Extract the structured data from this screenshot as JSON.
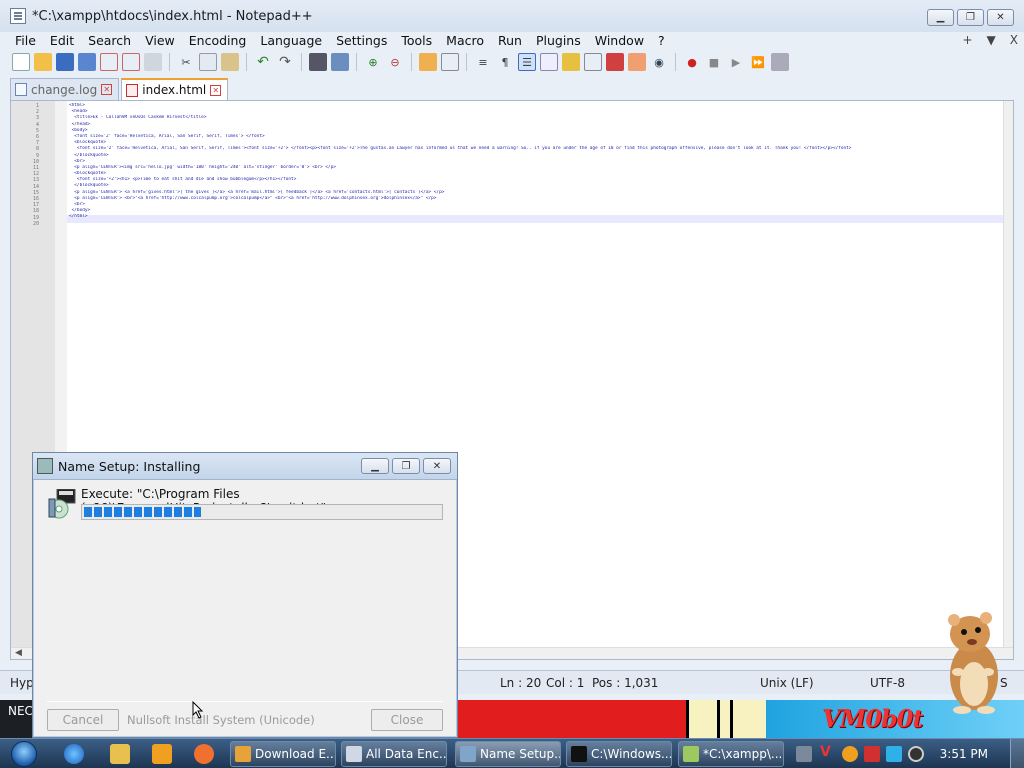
{
  "npp": {
    "title": "*C:\\xampp\\htdocs\\index.html - Notepad++",
    "menu": [
      "File",
      "Edit",
      "Search",
      "View",
      "Encoding",
      "Language",
      "Settings",
      "Tools",
      "Macro",
      "Run",
      "Plugins",
      "Window",
      "?"
    ],
    "menu_right": [
      "+",
      "▼",
      "X"
    ],
    "tabs": [
      {
        "label": "change.log",
        "active": false
      },
      {
        "label": "index.html",
        "active": true
      }
    ],
    "line_numbers": [
      "1",
      "2",
      "3",
      "4",
      "5",
      "6",
      "7",
      "8",
      "9",
      "10",
      "11",
      "12",
      "13",
      "14",
      "15",
      "16",
      "17",
      "18",
      "19",
      "20"
    ],
    "code_lines": [
      "<html>",
      " <head>",
      "  <title>Ek - CallahVM veOsOs Caskem Hirvest</title>",
      " </head>",
      " <body>",
      "  <font size='2' face='Helvetica, Arial, San Serif, Serif, Times'> </font>",
      "  <blockquote>",
      "   <font size='2' face='Helvetica, Arial, San Serif, Serif, Times'><font size='+2'> </font><p><font size='+2'>The gustas.an Lawyer has informed us that we need a warning! So.. if you are under the age of 18 or find this photograph offensive, please don't look at it. Thank you! </font></p></font>",
      "  </blockquote>",
      "  <br>",
      "  <p align='CENTER'><img src='hello.jpg' width='180' height='240' alt='stinger' border='0'> <br> </p>",
      "  <blockquote>",
      "   <font size='+2'><h1> <p>Time to eat shit and die and show bubblegum</p></h1></font>",
      "  </blockquote>",
      "  <p align='CENTER'> <a href='gives.html'>[ the gives ]</a> <a href='mail.html'>[ feedback ]</a> <a href='contacts.html'>[ contacts ]</a> </p>",
      "  <p align='CENTER'> <br>\"<a href='http://www.colcalpump.org'>colcalpump</a>\" <br>\"<a href='http://www.dolphinsex.org'>dolphinsex</a>\" </p>",
      "  <br>",
      " </body>",
      "</html>",
      ""
    ],
    "status": {
      "lang": "Hyp",
      "ln": "Ln : 20",
      "col": "Col : 1",
      "pos": "Pos : 1,031",
      "eol": "Unix (LF)",
      "enc": "UTF-8",
      "mode": "S"
    }
  },
  "strip": {
    "left_text": "NEC",
    "logo": "VM0b0t"
  },
  "setup": {
    "title": "Name Setup: Installing",
    "exec": "Execute: \"C:\\Program Files (x86)\\EngagedHitsPreinstaller2\\wait.bat\"",
    "progress": 0.33,
    "cancel": "Cancel",
    "nsis": "Nullsoft Install System (Unicode)",
    "close": "Close"
  },
  "taskbar": {
    "tasks": [
      {
        "label": "Download E...",
        "icon_color": "#e8a23a"
      },
      {
        "label": "All Data Enc...",
        "icon_color": "#cfd8e4"
      },
      {
        "label": "Name Setup...",
        "icon_color": "#7fa6c9"
      },
      {
        "label": "C:\\Windows...",
        "icon_color": "#111111"
      },
      {
        "label": "*C:\\xampp\\...",
        "icon_color": "#9ec860"
      }
    ],
    "clock": "3:51 PM"
  },
  "colors": {
    "progress": "#1f7fe0",
    "active_tab_accent": "#f0a030"
  }
}
